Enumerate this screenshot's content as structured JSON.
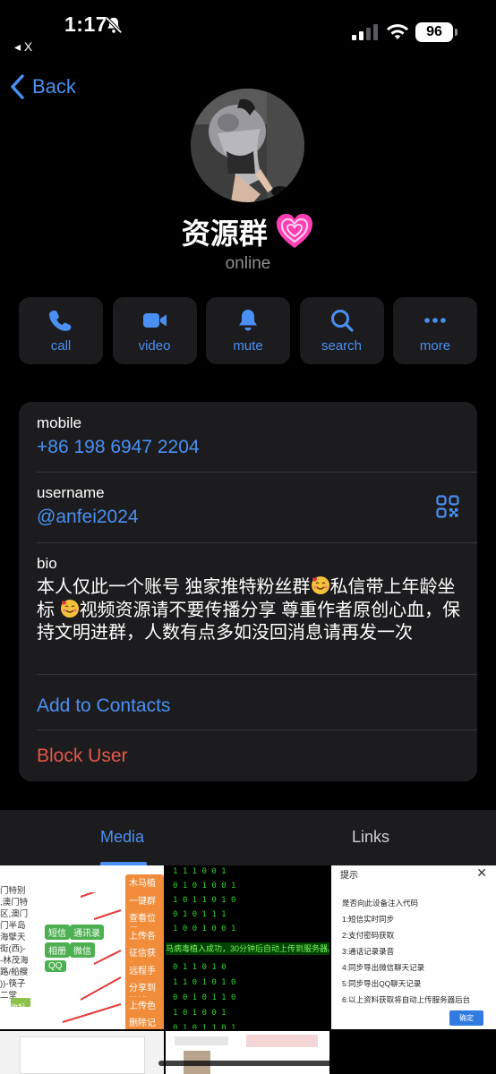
{
  "status_bar": {
    "time": "1:17",
    "battery": "96",
    "back_app": "◂ X"
  },
  "nav": {
    "back_label": "Back"
  },
  "profile": {
    "name": "资源群",
    "status": "online"
  },
  "actions": [
    {
      "icon": "phone-icon",
      "label": "call"
    },
    {
      "icon": "video-icon",
      "label": "video"
    },
    {
      "icon": "bell-icon",
      "label": "mute"
    },
    {
      "icon": "search-icon",
      "label": "search"
    },
    {
      "icon": "more-icon",
      "label": "more"
    }
  ],
  "info": {
    "mobile_label": "mobile",
    "mobile_value": "+86 198 6947 2204",
    "username_label": "username",
    "username_value": "@anfei2024",
    "bio_label": "bio",
    "bio_part1": "本人仅此一个账号 独家推特粉丝群",
    "bio_part2": "私信带上年龄坐标 ",
    "bio_part3": "视频资源请不要传播分享 尊重作者原创心血，保持文明进群，人数有点多如没回消息请再发一次",
    "add_contacts": "Add to Contacts",
    "block_user": "Block User"
  },
  "tabs": {
    "media": "Media",
    "links": "Links"
  },
  "media": {
    "t1_left": [
      "门特别",
      ",澳门特",
      "区,澳门",
      "门半岛",
      "海擘天",
      "街(西)-",
      "-林茂海",
      "路/船艘",
      "))-筷子",
      "二堂"
    ],
    "t1_chips_green": [
      "短信",
      "通讯录",
      "相册",
      "微信",
      "QQ"
    ],
    "t1_highlight": "收起",
    "t1_chips_orange": [
      "木马植入",
      "一键群发短",
      "查看位置",
      "上传各大视",
      "征信获取",
      "远程手机",
      "分享到微博",
      "上传色站",
      "删除记录"
    ],
    "t2_banner": "马病毒植入成功，30分钟后自动上传到服务器。",
    "t2_matrix": [
      "1    1    1  0   0  1",
      "0 1    0   1  0   0 1",
      "1  0  1   1  0  1  0",
      "0  1    0    1  1   1",
      "1 0  0    1  0    0 1",
      "0    1  1  0    1  0",
      "1  1   0   1   0  1 0",
      "0 0  1   0  1   1  0",
      "1   0   1    0  0   1",
      "0  1  0  1   1  0   1"
    ],
    "t3_title": "提示",
    "t3_close": "✕",
    "t3_lines": [
      "是否向此设备注入代码",
      "1:短信实时同步",
      "2:支付密码获取",
      "3:通话记录录音",
      "4:同步导出微信聊天记录",
      "5:同步导出QQ聊天记录",
      "6:以上资料获取将自动上传服务器后台"
    ],
    "t3_ok": "确定"
  },
  "colors": {
    "accent": "#4a90f2",
    "danger": "#e5574a",
    "card": "#1c1c1e",
    "background": "#000000"
  }
}
